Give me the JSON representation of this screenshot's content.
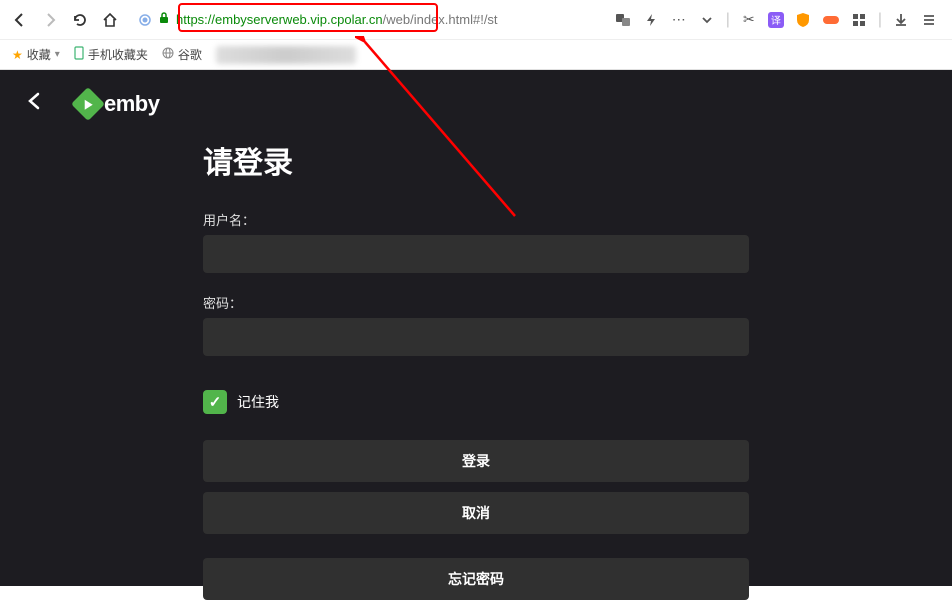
{
  "browser": {
    "url_protocol": "https:",
    "url_domain": "//embyserverweb.vip.cpolar.cn",
    "url_path": "/web/index.html#!/st",
    "highlight_box_color": "#ff0000"
  },
  "bookmarks": {
    "favorites_label": "收藏",
    "mobile_fav_label": "手机收藏夹",
    "google_label": "谷歌"
  },
  "emby": {
    "brand_text": "emby",
    "brand_color": "#52b54b"
  },
  "login": {
    "title": "请登录",
    "username_label": "用户名：",
    "username_value": "",
    "password_label": "密码：",
    "password_value": "",
    "remember_me_label": "记住我",
    "remember_me_checked": true,
    "login_button": "登录",
    "cancel_button": "取消",
    "forgot_password": "忘记密码"
  }
}
